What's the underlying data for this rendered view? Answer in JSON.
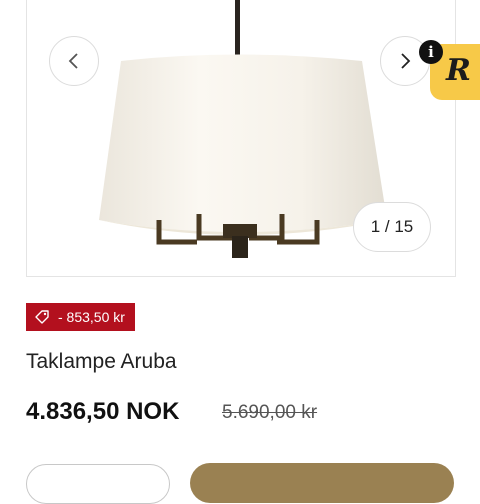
{
  "gallery": {
    "image_alt": "Taklampe Aruba",
    "counter": "1 / 15",
    "prev_icon": "chevron-left-icon",
    "next_icon": "chevron-right-icon"
  },
  "extension_badge": {
    "letter": "R",
    "info": "i"
  },
  "product": {
    "discount_label": "- 853,50 kr",
    "discount_icon": "price-tag-icon",
    "title": "Taklampe Aruba",
    "price": "4.836,50 NOK",
    "old_price": "5.690,00 kr"
  },
  "colors": {
    "discount_bg": "#b3101e",
    "cta_bg": "#9a8152",
    "badge_bg": "#f7c948"
  }
}
